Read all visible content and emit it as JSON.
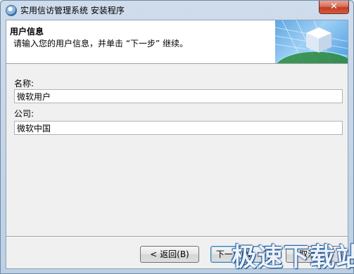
{
  "window": {
    "title": "实用信访管理系统 安装程序",
    "close_label": "✕"
  },
  "header": {
    "title": "用户信息",
    "subtitle": "请输入您的用户信息，并单击 “下一步” 继续。"
  },
  "form": {
    "name_label": "名称:",
    "name_value": "微软用户",
    "company_label": "公司:",
    "company_value": "微软中国"
  },
  "buttons": {
    "back": "< 返回(B)",
    "next": "下一步(N) >",
    "cancel": "取消(C)"
  },
  "watermark": "极速下载站",
  "icons": [
    "app-installer-icon",
    "close-icon",
    "cube-globe-art-icon"
  ]
}
